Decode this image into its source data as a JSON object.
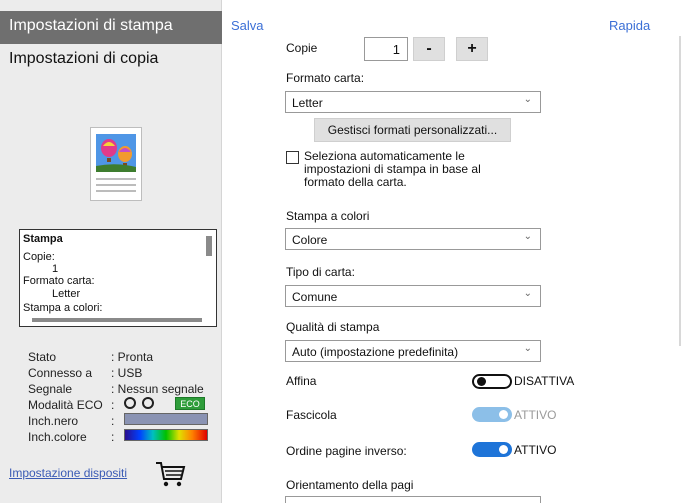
{
  "left_panel": {
    "tab_print": "Impostazioni di stampa",
    "tab_copy": "Impostazioni di copia",
    "summary": {
      "title": "Stampa",
      "copies_label": "Copie:",
      "copies_value": "1",
      "paper_label": "Formato carta:",
      "paper_value": "Letter",
      "color_label": "Stampa a colori:"
    },
    "status": [
      {
        "label": "Stato",
        "value": ": Pronta"
      },
      {
        "label": "Connesso a",
        "value": ": USB"
      },
      {
        "label": "Segnale",
        "value": ": Nessun segnale"
      },
      {
        "label": "Modalità ECO",
        "value": ":"
      },
      {
        "label": "Inch.nero",
        "value": ":"
      },
      {
        "label": "Inch.colore",
        "value": ":"
      }
    ],
    "eco_badge": "ECO",
    "ink_black_level": 1.0,
    "ink_color_level": 1.0,
    "device_link": "Impostazione dispositi"
  },
  "header": {
    "save": "Salva",
    "quick": "Rapida"
  },
  "settings": {
    "copies_label": "Copie",
    "copies_value": "1",
    "minus": "-",
    "plus": "+",
    "paper_size_label": "Formato carta:",
    "paper_size_value": "Letter",
    "manage_sizes_button": "Gestisci formati personalizzati...",
    "auto_select_text": "Seleziona automaticamente le impostazioni di stampa in base al formato della carta.",
    "auto_select_checked": false,
    "color_label": "Stampa a colori",
    "color_value": "Colore",
    "paper_type_label": "Tipo di carta:",
    "paper_type_value": "Comune",
    "quality_label": "Qualità di stampa",
    "quality_value": "Auto (impostazione predefinita)",
    "sharpen_label": "Affina",
    "sharpen_state": "DISATTIVA",
    "collate_label": "Fascicola",
    "collate_state": "ATTIVO",
    "reverse_label": "Ordine pagine inverso:",
    "reverse_state": "ATTIVO",
    "orientation_label": "Orientamento della pagi"
  },
  "colors": {
    "link": "#3b6fd6",
    "toggle_on": "#1e74d8",
    "toggle_disabled": "#8cbfe8",
    "eco_green": "#2e9d3a"
  }
}
